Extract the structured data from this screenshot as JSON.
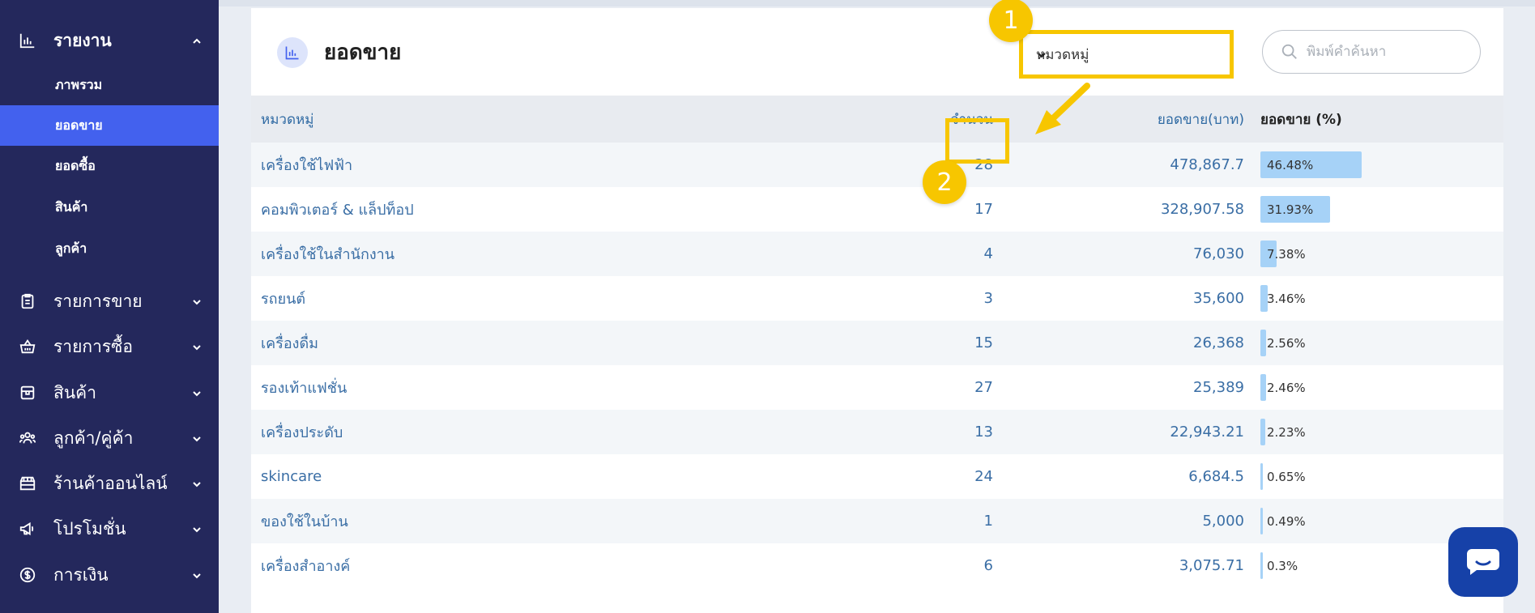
{
  "sidebar": {
    "report_label": "รายงาน",
    "sub_items": [
      {
        "label": "ภาพรวม"
      },
      {
        "label": "ยอดขาย"
      },
      {
        "label": "ยอดซื้อ"
      },
      {
        "label": "สินค้า"
      },
      {
        "label": "ลูกค้า"
      }
    ],
    "items": [
      {
        "label": "รายการขาย",
        "icon": "clipboard-icon"
      },
      {
        "label": "รายการซื้อ",
        "icon": "basket-icon"
      },
      {
        "label": "สินค้า",
        "icon": "box-icon"
      },
      {
        "label": "ลูกค้า/คู่ค้า",
        "icon": "users-icon"
      },
      {
        "label": "ร้านค้าออนไลน์",
        "icon": "store-icon"
      },
      {
        "label": "โปรโมชั่น",
        "icon": "megaphone-icon"
      },
      {
        "label": "การเงิน",
        "icon": "dollar-icon"
      }
    ]
  },
  "header": {
    "title": "ยอดขาย",
    "select_value": "หมวดหมู่",
    "search_placeholder": "พิมพ์คำค้นหา"
  },
  "table": {
    "columns": {
      "category": "หมวดหมู่",
      "count": "จำนวน",
      "sales": "ยอดขาย(บาท)",
      "percent": "ยอดขาย (%)"
    },
    "rows": [
      {
        "category": "เครื่องใช้ไฟฟ้า",
        "count": "28",
        "sales": "478,867.7",
        "percent": "46.48%",
        "pct": 46.48
      },
      {
        "category": "คอมพิวเตอร์ & แล็ปท็อป",
        "count": "17",
        "sales": "328,907.58",
        "percent": "31.93%",
        "pct": 31.93
      },
      {
        "category": "เครื่องใช้ในสำนักงาน",
        "count": "4",
        "sales": "76,030",
        "percent": "7.38%",
        "pct": 7.38
      },
      {
        "category": "รถยนต์",
        "count": "3",
        "sales": "35,600",
        "percent": "3.46%",
        "pct": 3.46
      },
      {
        "category": "เครื่องดื่ม",
        "count": "15",
        "sales": "26,368",
        "percent": "2.56%",
        "pct": 2.56
      },
      {
        "category": "รองเท้าแฟชั่น",
        "count": "27",
        "sales": "25,389",
        "percent": "2.46%",
        "pct": 2.46
      },
      {
        "category": "เครื่องประดับ",
        "count": "13",
        "sales": "22,943.21",
        "percent": "2.23%",
        "pct": 2.23
      },
      {
        "category": "skincare",
        "count": "24",
        "sales": "6,684.5",
        "percent": "0.65%",
        "pct": 0.65
      },
      {
        "category": "ของใช้ในบ้าน",
        "count": "1",
        "sales": "5,000",
        "percent": "0.49%",
        "pct": 0.49
      },
      {
        "category": "เครื่องสำอางค์",
        "count": "6",
        "sales": "3,075.71",
        "percent": "0.3%",
        "pct": 0.3
      }
    ]
  },
  "annotations": {
    "badge1": "1",
    "badge2": "2"
  },
  "colors": {
    "sidebar": "#24285c",
    "active": "#4361ee",
    "highlight": "#f7c600",
    "bar": "#a6d2f7",
    "chat": "#1641a8"
  }
}
